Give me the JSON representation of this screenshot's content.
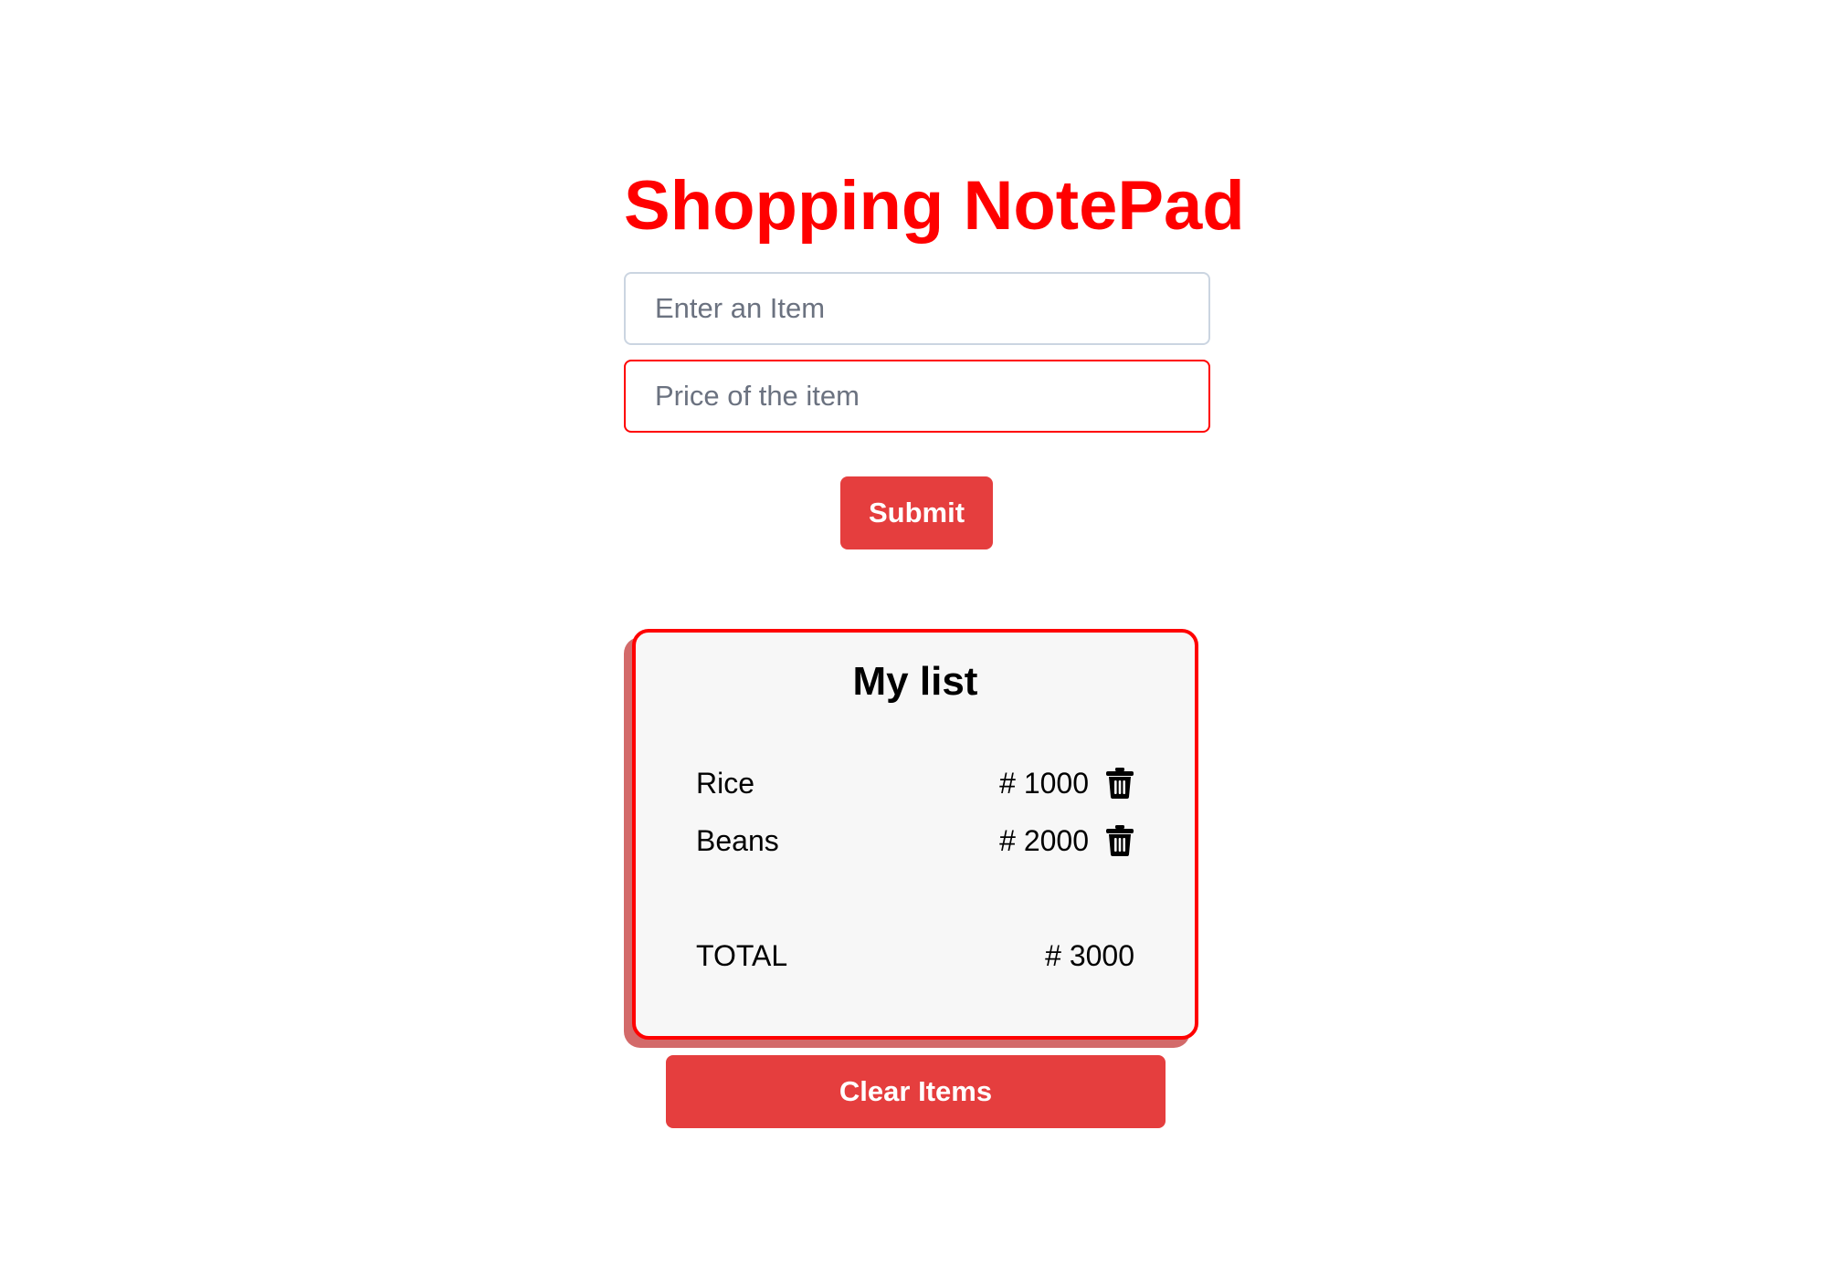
{
  "app": {
    "title": "Shopping NotePad"
  },
  "form": {
    "item_placeholder": "Enter an Item",
    "item_value": "",
    "price_placeholder": "Price of the item",
    "price_value": "",
    "submit_label": "Submit"
  },
  "list": {
    "title": "My list",
    "items": [
      {
        "name": "Rice",
        "price": "# 1000",
        "delete_icon": "trash-icon"
      },
      {
        "name": "Beans",
        "price": "# 2000",
        "delete_icon": "trash-icon"
      }
    ],
    "total_label": "TOTAL",
    "total_value": "# 3000"
  },
  "actions": {
    "clear_label": "Clear Items"
  },
  "colors": {
    "accent": "#ff0000",
    "button": "#e53e3e",
    "card_background": "#f7f7f7",
    "card_shadow": "#d36a6a"
  }
}
